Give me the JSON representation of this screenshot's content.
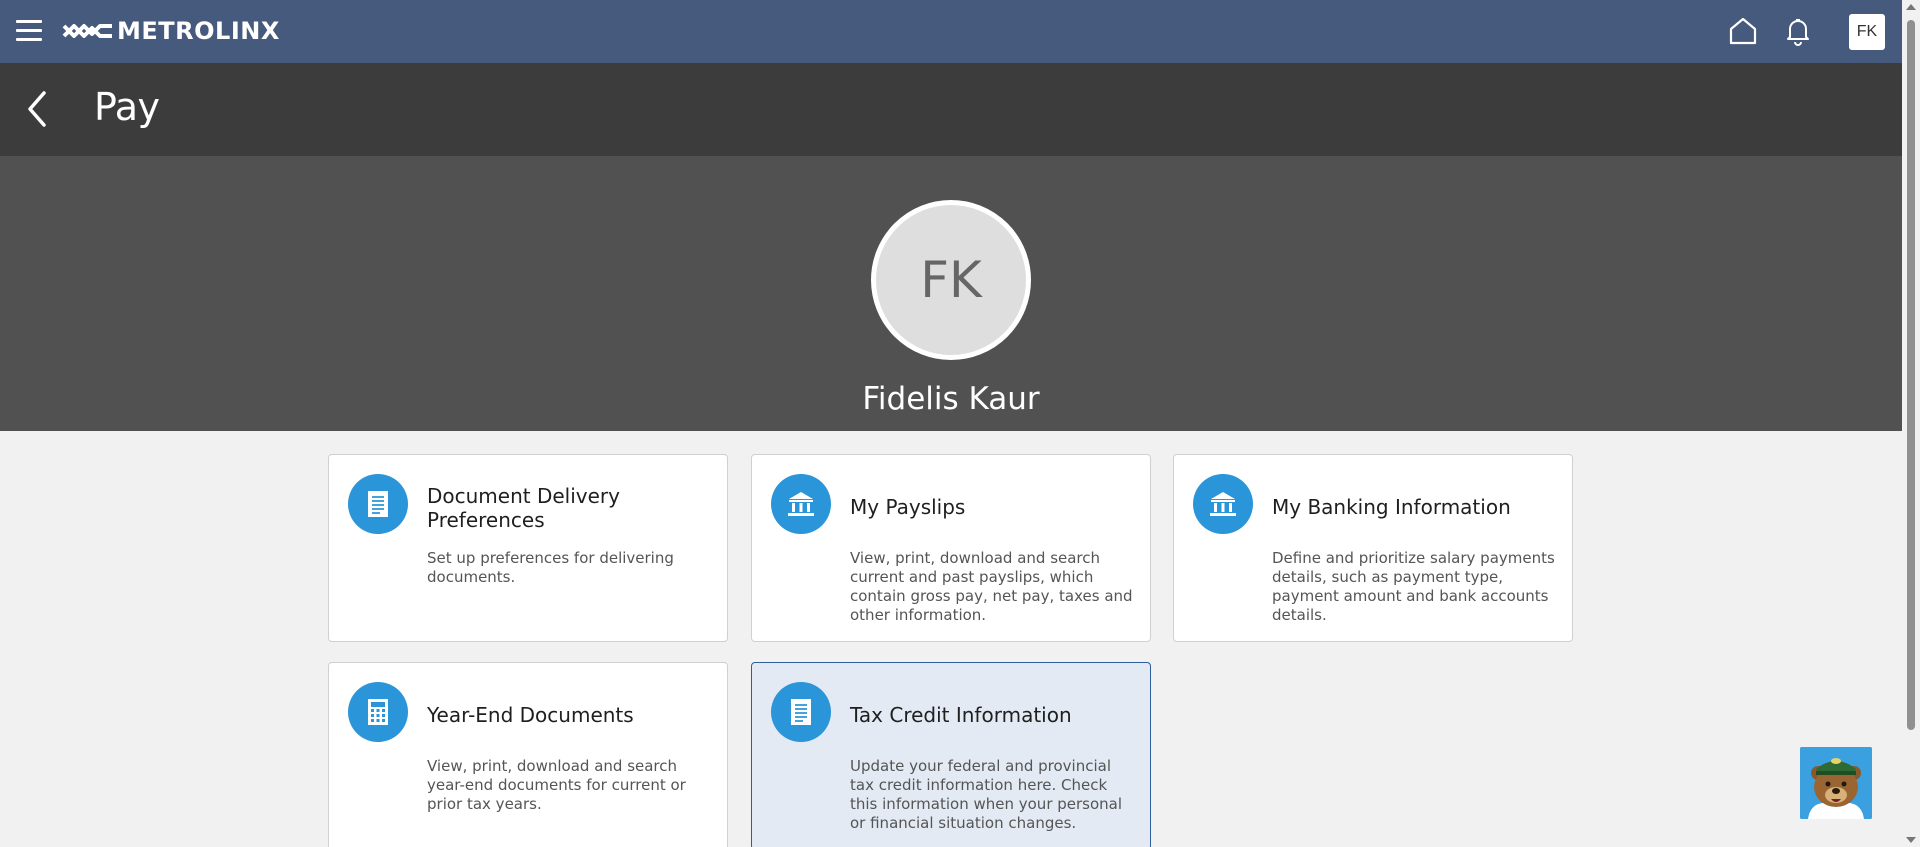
{
  "header": {
    "brand": "METROLINX",
    "user_initials": "FK"
  },
  "page": {
    "title": "Pay"
  },
  "profile": {
    "initials": "FK",
    "name": "Fidelis Kaur"
  },
  "cards": [
    {
      "title": "Document Delivery Preferences",
      "description": "Set up preferences for delivering documents.",
      "icon": "document-icon"
    },
    {
      "title": "My Payslips",
      "description": "View, print, download and search current and past payslips, which contain gross pay, net pay, taxes and other information.",
      "icon": "bank-icon"
    },
    {
      "title": "My Banking Information",
      "description": "Define and prioritize salary payments details, such as payment type, payment amount and bank accounts details.",
      "icon": "bank-icon"
    },
    {
      "title": "Year-End Documents",
      "description": "View, print, download and search year-end documents for current or prior tax years.",
      "icon": "calculator-icon"
    },
    {
      "title": "Tax Credit Information",
      "description": "Update your federal and provincial tax credit information here. Check this information when your personal or financial situation changes.",
      "icon": "document-icon"
    }
  ],
  "colors": {
    "topbar": "#455a7c",
    "page_header": "#3c3c3c",
    "profile_banner": "#515151",
    "icon_circle": "#2a95d8",
    "selected_card": "#e3eaf4"
  }
}
